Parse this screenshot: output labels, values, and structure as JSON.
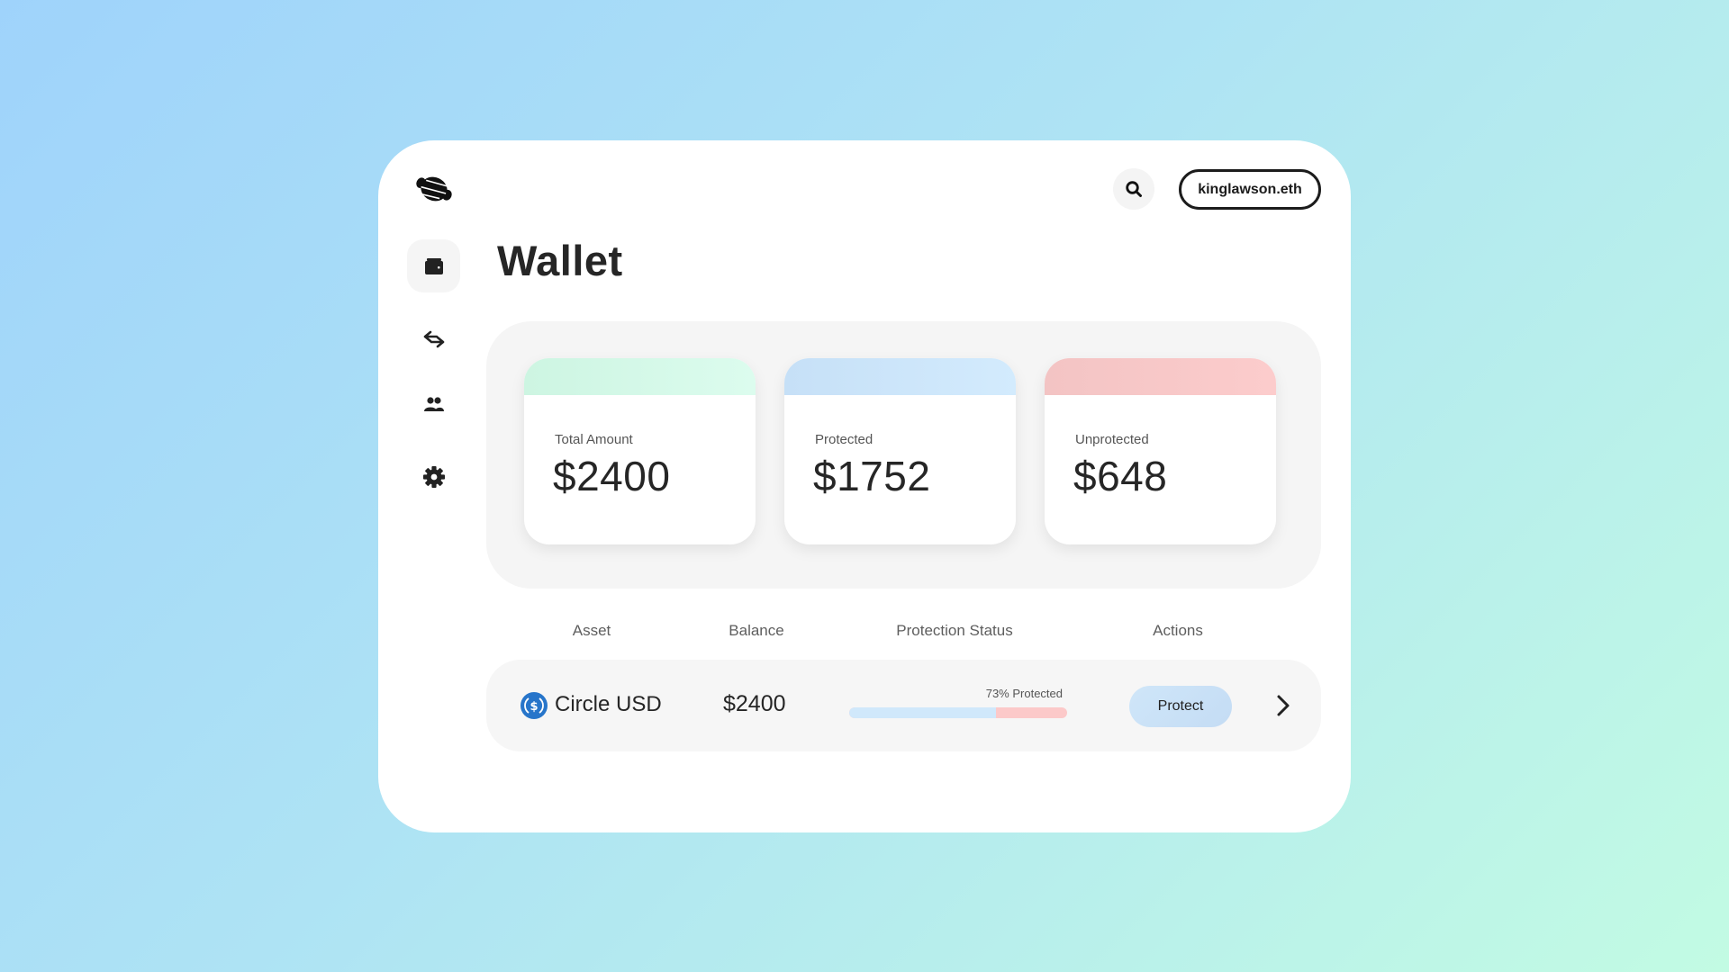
{
  "app": {
    "logo": "croissant-logo-icon"
  },
  "header": {
    "title": "Wallet",
    "search_icon": "search-icon",
    "user_label": "kinglawson.eth"
  },
  "sidebar": {
    "items": [
      {
        "name": "wallet",
        "icon": "wallet-icon",
        "active": true
      },
      {
        "name": "transfer",
        "icon": "arrows-exchange-icon",
        "active": false
      },
      {
        "name": "contacts",
        "icon": "people-icon",
        "active": false
      },
      {
        "name": "settings",
        "icon": "gear-icon",
        "active": false
      }
    ]
  },
  "stats": [
    {
      "label": "Total Amount",
      "value": "$2400",
      "accent": "#d4f7e6"
    },
    {
      "label": "Protected",
      "value": "$1752",
      "accent": "#cde6fb"
    },
    {
      "label": "Unprotected",
      "value": "$648",
      "accent": "#f8c9c9"
    }
  ],
  "table": {
    "headers": [
      "Asset",
      "Balance",
      "Protection Status",
      "Actions"
    ],
    "rows": [
      {
        "asset": "Circle USD",
        "asset_icon": "usdc-coin-icon",
        "balance": "$2400",
        "protection_label": "73% Protected",
        "protected_fraction": 0.73,
        "action_label": "Protect"
      }
    ]
  },
  "colors": {
    "protected": "#d0e8fb",
    "unprotected": "#fcc9c9",
    "usdc_blue": "#2775ca",
    "text": "#262626"
  }
}
